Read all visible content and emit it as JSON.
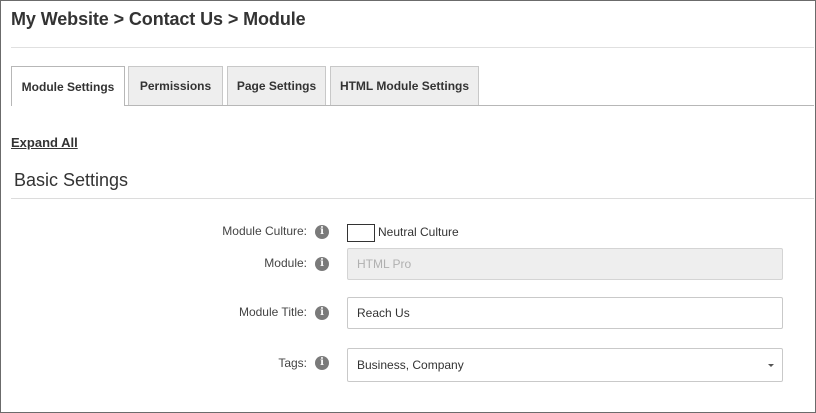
{
  "breadcrumb": "My Website > Contact Us > Module",
  "tabs": [
    {
      "label": "Module Settings",
      "active": true
    },
    {
      "label": "Permissions",
      "active": false
    },
    {
      "label": "Page Settings",
      "active": false
    },
    {
      "label": "HTML Module Settings",
      "active": false
    }
  ],
  "expand_all": "Expand All",
  "section": {
    "title": "Basic Settings"
  },
  "form": {
    "module_culture": {
      "label": "Module Culture:",
      "checkbox_label": "Neutral Culture",
      "checked": false
    },
    "module": {
      "label": "Module:",
      "placeholder": "HTML Pro"
    },
    "module_title": {
      "label": "Module Title:",
      "value": "Reach Us"
    },
    "tags": {
      "label": "Tags:",
      "value": "Business, Company"
    }
  },
  "icons": {
    "info": "info-icon",
    "caret": "chevron-down-icon"
  },
  "colors": {
    "border": "#6b6b6b",
    "tab_inactive": "#eeeeee",
    "disabled_input": "#eeeeee",
    "info_icon": "#7a7a7a"
  }
}
